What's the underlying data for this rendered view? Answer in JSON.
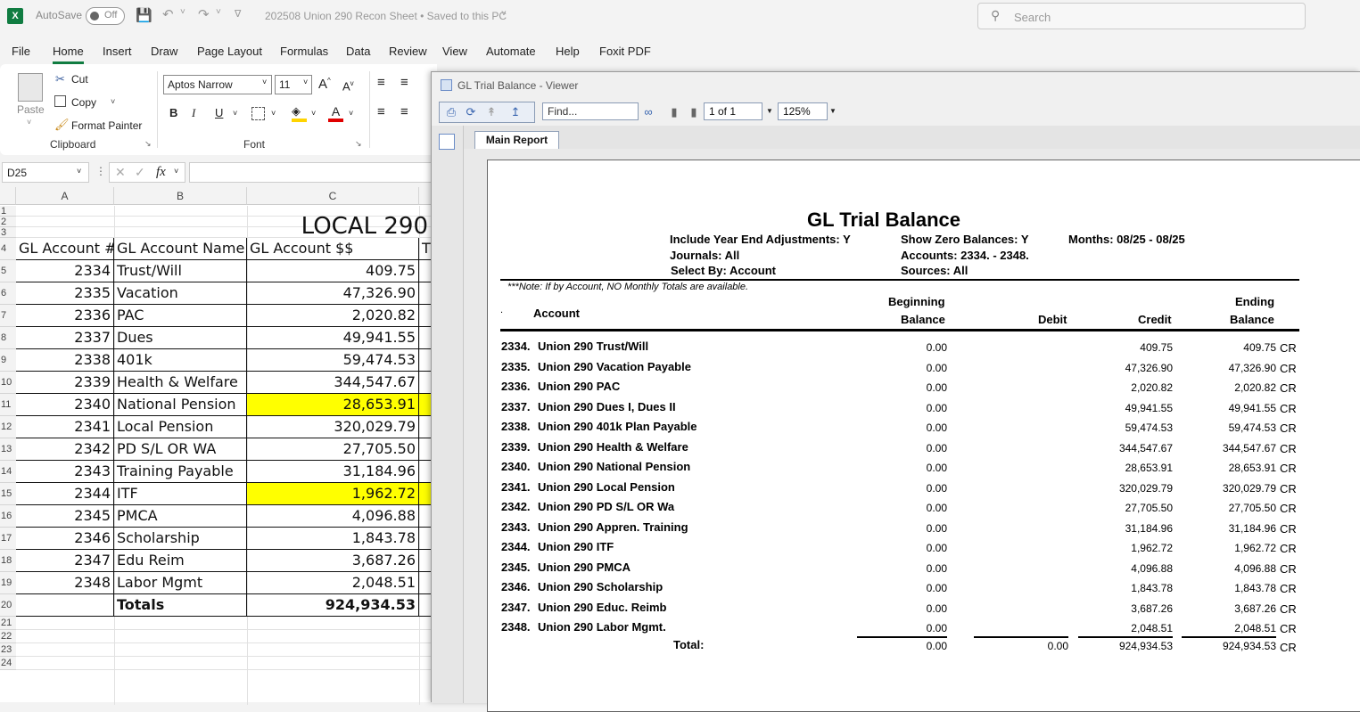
{
  "titlebar": {
    "autosave_label": "AutoSave",
    "autosave_state": "Off",
    "document_name": "202508 Union 290 Recon Sheet • Saved to this PC",
    "search_placeholder": "Search"
  },
  "menu": [
    "File",
    "Home",
    "Insert",
    "Draw",
    "Page Layout",
    "Formulas",
    "Data",
    "Review",
    "View",
    "Automate",
    "Help",
    "Foxit PDF"
  ],
  "ribbon": {
    "paste": "Paste",
    "cut": "Cut",
    "copy": "Copy",
    "format_painter": "Format Painter",
    "clipboard_group": "Clipboard",
    "font_name": "Aptos Narrow",
    "font_size": "11",
    "font_group": "Font"
  },
  "formula_bar": {
    "name_box": "D25",
    "fx": "fx",
    "content": ""
  },
  "sheet": {
    "columns": [
      "A",
      "B",
      "C"
    ],
    "rows": [
      "1",
      "2",
      "3",
      "4",
      "5",
      "6",
      "7",
      "8",
      "9",
      "10",
      "11",
      "12",
      "13",
      "14",
      "15",
      "16",
      "17",
      "18",
      "19",
      "20",
      "21",
      "22",
      "23",
      "24"
    ],
    "title": "LOCAL 290",
    "headers": {
      "a": "GL Account #",
      "b": "GL Account Name",
      "c": "GL Account $$",
      "d": "T"
    },
    "data": [
      {
        "acct": "2334",
        "name": "Trust/Will",
        "amount": "409.75",
        "highlight": false
      },
      {
        "acct": "2335",
        "name": "Vacation",
        "amount": "47,326.90",
        "highlight": false
      },
      {
        "acct": "2336",
        "name": "PAC",
        "amount": "2,020.82",
        "highlight": false
      },
      {
        "acct": "2337",
        "name": "Dues",
        "amount": "49,941.55",
        "highlight": false
      },
      {
        "acct": "2338",
        "name": "401k",
        "amount": "59,474.53",
        "highlight": false
      },
      {
        "acct": "2339",
        "name": "Health & Welfare",
        "amount": "344,547.67",
        "highlight": false
      },
      {
        "acct": "2340",
        "name": "National Pension",
        "amount": "28,653.91",
        "highlight": true
      },
      {
        "acct": "2341",
        "name": "Local Pension",
        "amount": "320,029.79",
        "highlight": false
      },
      {
        "acct": "2342",
        "name": "PD S/L OR  WA",
        "amount": "27,705.50",
        "highlight": false
      },
      {
        "acct": "2343",
        "name": "Training Payable",
        "amount": "31,184.96",
        "highlight": false
      },
      {
        "acct": "2344",
        "name": "ITF",
        "amount": "1,962.72",
        "highlight": true
      },
      {
        "acct": "2345",
        "name": "PMCA",
        "amount": "4,096.88",
        "highlight": false
      },
      {
        "acct": "2346",
        "name": "Scholarship",
        "amount": "1,843.78",
        "highlight": false
      },
      {
        "acct": "2347",
        "name": "Edu Reim",
        "amount": "3,687.26",
        "highlight": false
      },
      {
        "acct": "2348",
        "name": "Labor Mgmt",
        "amount": "2,048.51",
        "highlight": false
      }
    ],
    "totals_label": "Totals",
    "totals_amount": "924,934.53",
    "highlight_color": "#ffff00"
  },
  "viewer": {
    "window_title": "GL Trial Balance - Viewer",
    "find_placeholder": "Find...",
    "page_indicator": "1 of 1",
    "zoom": "125%",
    "tab": "Main Report",
    "report": {
      "title": "GL Trial Balance",
      "include_ye": "Include Year End Adjustments:  Y",
      "journals": "Journals:  All",
      "select_by": "Select By:  Account",
      "show_zero": "Show Zero Balances:  Y",
      "accounts": "Accounts:  2334. - 2348.",
      "sources": "Sources:  All",
      "months": "Months: 08/25 - 08/25",
      "note": "***Note:  If by Account, NO Monthly Totals are available.",
      "col_account": "Account",
      "col_beginning_1": "Beginning",
      "col_beginning_2": "Balance",
      "col_debit": "Debit",
      "col_credit": "Credit",
      "col_ending_1": "Ending",
      "col_ending_2": "Balance",
      "dot_marker": ".",
      "rows": [
        {
          "acct": "2334.",
          "name": "Union 290 Trust/Will",
          "begin": "0.00",
          "credit": "409.75",
          "ending": "409.75",
          "flag": "CR"
        },
        {
          "acct": "2335.",
          "name": "Union 290 Vacation Payable",
          "begin": "0.00",
          "credit": "47,326.90",
          "ending": "47,326.90",
          "flag": "CR"
        },
        {
          "acct": "2336.",
          "name": "Union 290 PAC",
          "begin": "0.00",
          "credit": "2,020.82",
          "ending": "2,020.82",
          "flag": "CR"
        },
        {
          "acct": "2337.",
          "name": "Union 290 Dues I, Dues II",
          "begin": "0.00",
          "credit": "49,941.55",
          "ending": "49,941.55",
          "flag": "CR"
        },
        {
          "acct": "2338.",
          "name": "Union 290 401k Plan Payable",
          "begin": "0.00",
          "credit": "59,474.53",
          "ending": "59,474.53",
          "flag": "CR"
        },
        {
          "acct": "2339.",
          "name": "Union 290 Health & Welfare",
          "begin": "0.00",
          "credit": "344,547.67",
          "ending": "344,547.67",
          "flag": "CR"
        },
        {
          "acct": "2340.",
          "name": "Union 290 National Pension",
          "begin": "0.00",
          "credit": "28,653.91",
          "ending": "28,653.91",
          "flag": "CR"
        },
        {
          "acct": "2341.",
          "name": "Union 290 Local Pension",
          "begin": "0.00",
          "credit": "320,029.79",
          "ending": "320,029.79",
          "flag": "CR"
        },
        {
          "acct": "2342.",
          "name": "Union 290 PD S/L OR Wa",
          "begin": "0.00",
          "credit": "27,705.50",
          "ending": "27,705.50",
          "flag": "CR"
        },
        {
          "acct": "2343.",
          "name": "Union 290 Appren. Training",
          "begin": "0.00",
          "credit": "31,184.96",
          "ending": "31,184.96",
          "flag": "CR"
        },
        {
          "acct": "2344.",
          "name": "Union 290 ITF",
          "begin": "0.00",
          "credit": "1,962.72",
          "ending": "1,962.72",
          "flag": "CR"
        },
        {
          "acct": "2345.",
          "name": "Union 290 PMCA",
          "begin": "0.00",
          "credit": "4,096.88",
          "ending": "4,096.88",
          "flag": "CR"
        },
        {
          "acct": "2346.",
          "name": "Union 290 Scholarship",
          "begin": "0.00",
          "credit": "1,843.78",
          "ending": "1,843.78",
          "flag": "CR"
        },
        {
          "acct": "2347.",
          "name": "Union 290 Educ. Reimb",
          "begin": "0.00",
          "credit": "3,687.26",
          "ending": "3,687.26",
          "flag": "CR"
        },
        {
          "acct": "2348.",
          "name": "Union 290 Labor Mgmt.",
          "begin": "0.00",
          "credit": "2,048.51",
          "ending": "2,048.51",
          "flag": "CR"
        }
      ],
      "total_label": "Total:",
      "total_begin": "0.00",
      "total_debit": "0.00",
      "total_credit": "924,934.53",
      "total_ending": "924,934.53",
      "total_flag": "CR"
    }
  }
}
